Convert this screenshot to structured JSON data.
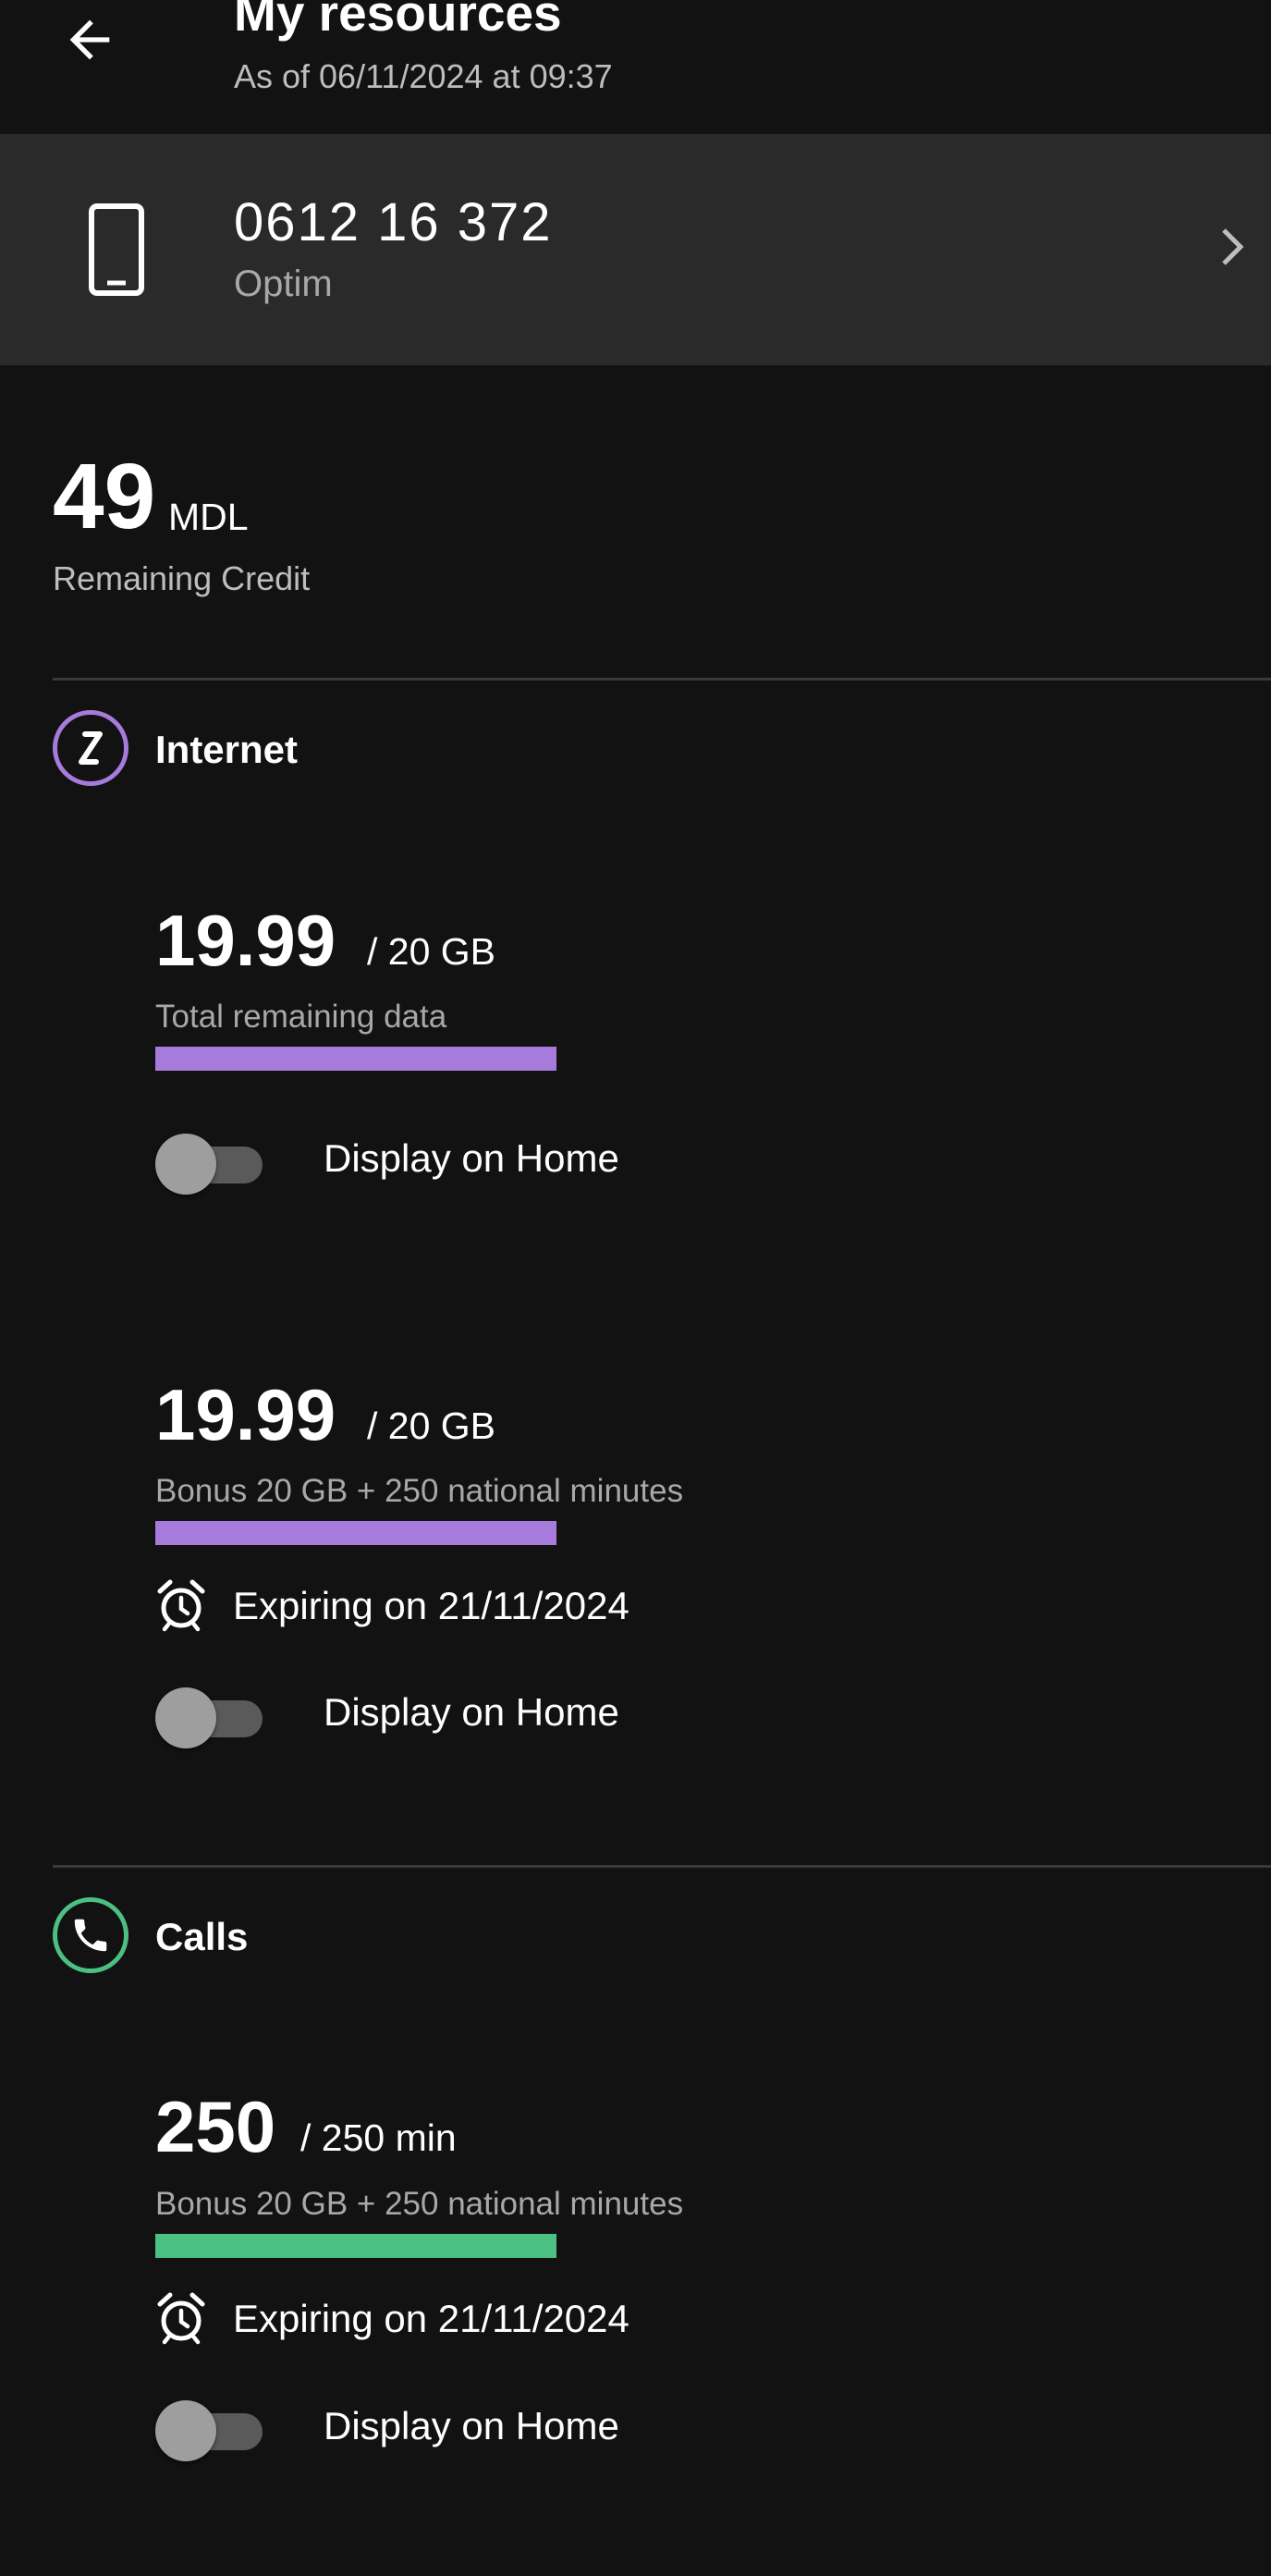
{
  "header": {
    "title": "My resources",
    "subtitle": "As of 06/11/2024 at 09:37",
    "back_icon": "arrow-left-icon"
  },
  "line": {
    "number": "0612 16 372",
    "plan": "Optim",
    "icon": "mobile-phone-icon",
    "chevron_icon": "chevron-right-icon"
  },
  "credit": {
    "amount": "49",
    "unit": "MDL",
    "label": "Remaining Credit"
  },
  "internet": {
    "title": "Internet",
    "icon": "internet-brand-icon",
    "accent": "#A77BDB",
    "items": [
      {
        "value": "19.99",
        "total": "/ 20 GB",
        "desc": "Total remaining data",
        "fraction": 0.9995,
        "toggle_label": "Display on Home",
        "toggle_on": false
      },
      {
        "value": "19.99",
        "total": "/ 20 GB",
        "desc": "Bonus 20 GB + 250 national minutes",
        "fraction": 0.9995,
        "expire": "Expiring on 21/11/2024",
        "toggle_label": "Display on Home",
        "toggle_on": false
      }
    ]
  },
  "calls": {
    "title": "Calls",
    "icon": "phone-icon",
    "accent": "#4CBF82",
    "items": [
      {
        "value": "250",
        "total": "/ 250 min",
        "desc": "Bonus 20 GB + 250 national minutes",
        "fraction": 1.0,
        "expire": "Expiring on 21/11/2024",
        "toggle_label": "Display on Home",
        "toggle_on": false
      }
    ]
  }
}
